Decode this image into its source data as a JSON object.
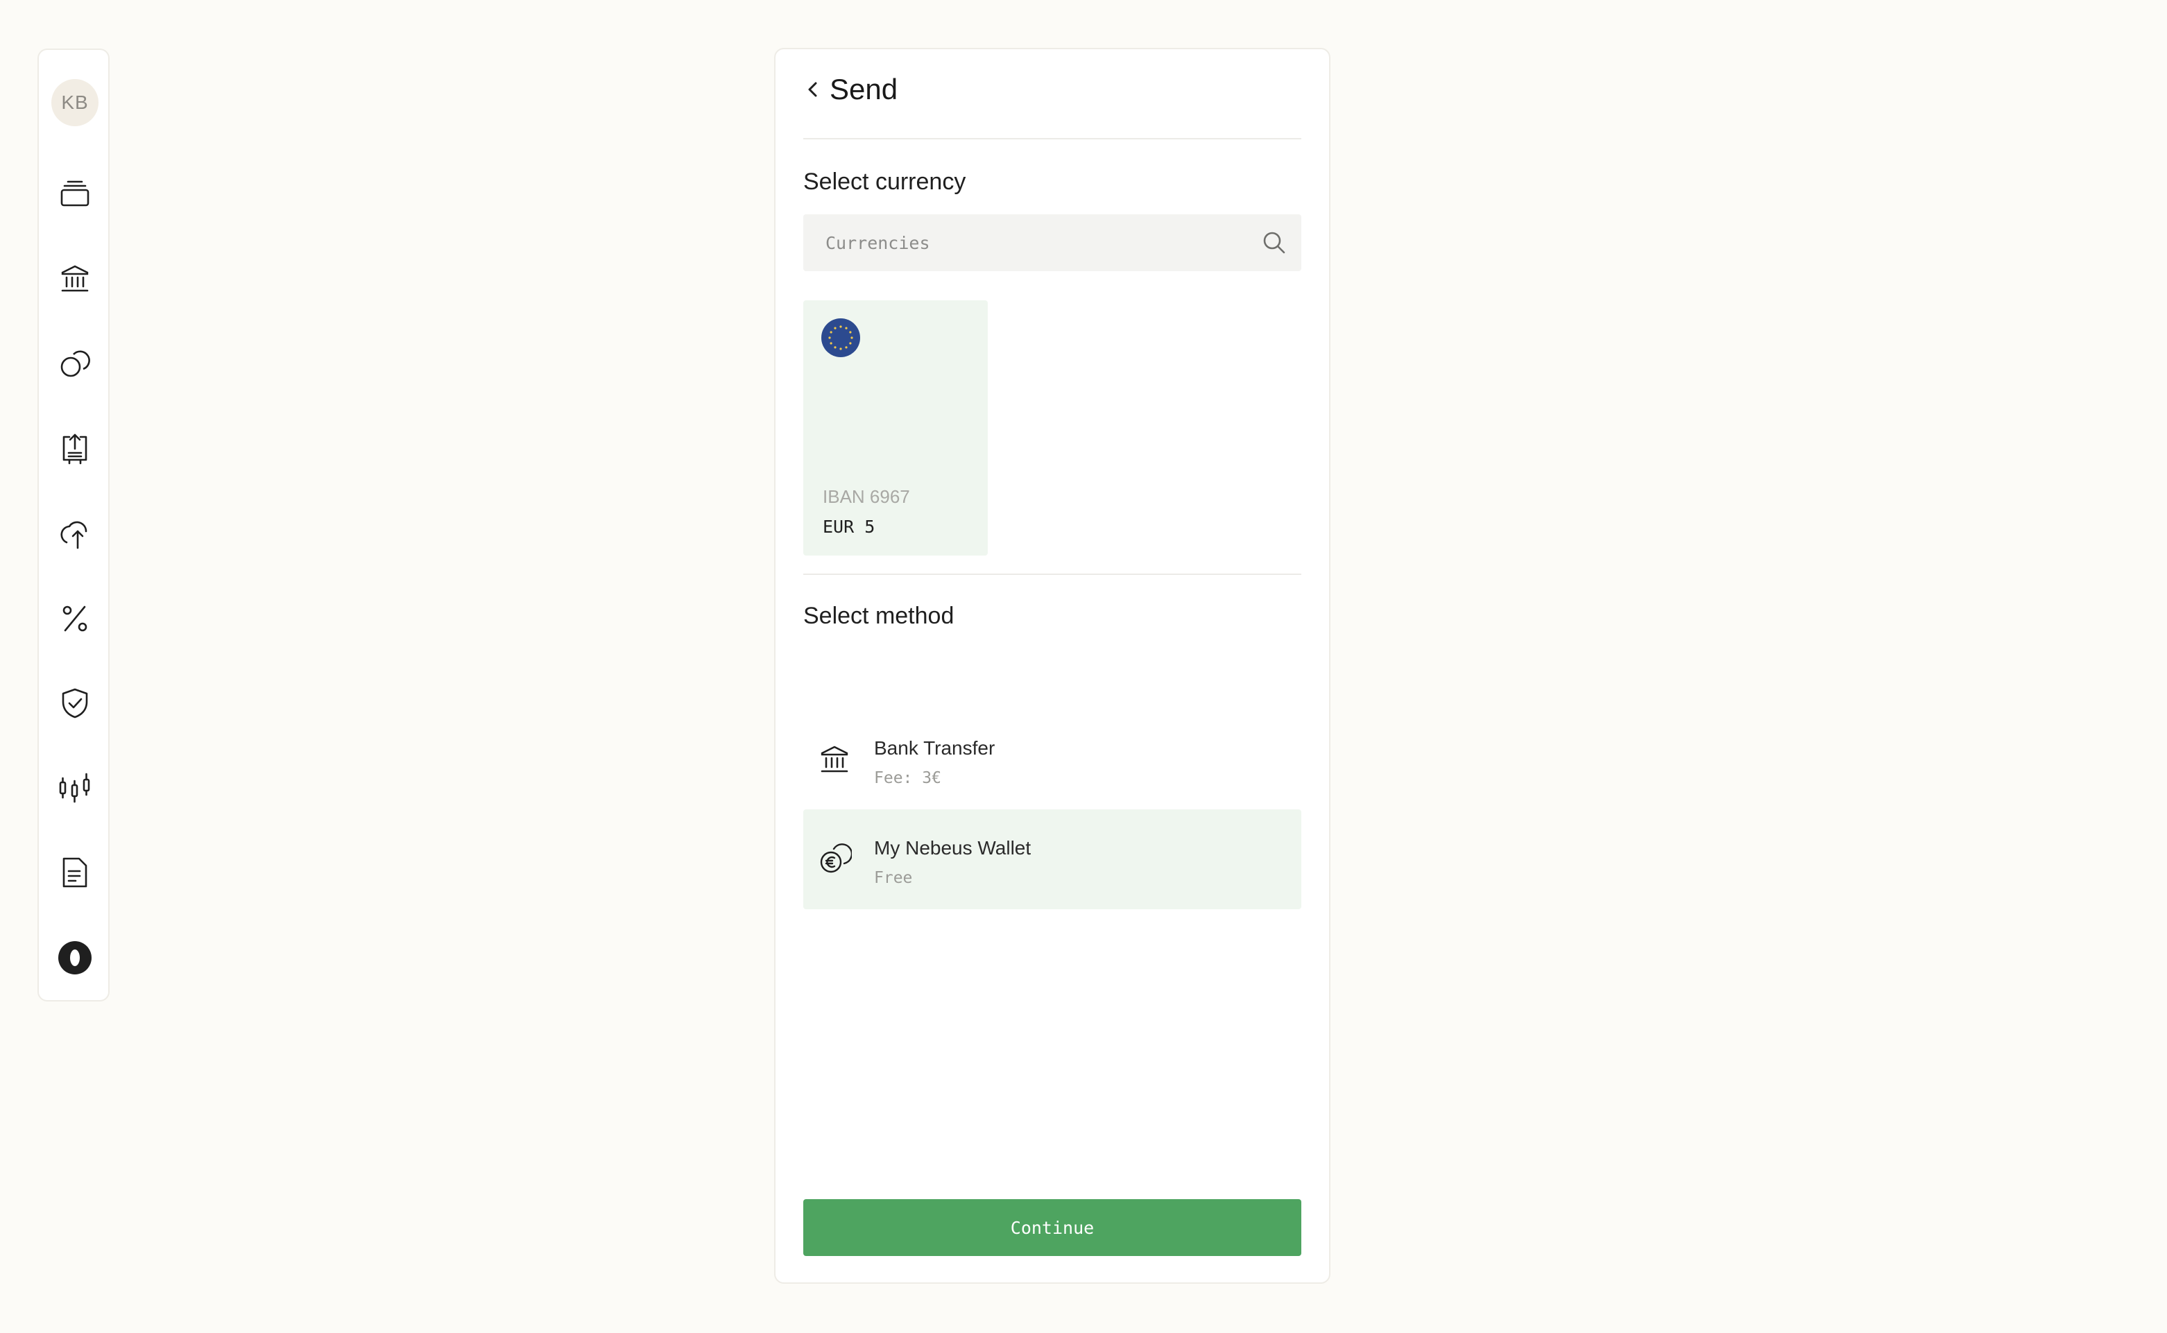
{
  "user": {
    "initials": "KB"
  },
  "sidebar": {
    "items": [
      {
        "icon": "cards-stack-icon"
      },
      {
        "icon": "bank-icon"
      },
      {
        "icon": "coins-icon"
      },
      {
        "icon": "upload-icon"
      },
      {
        "icon": "cloud-upload-icon"
      },
      {
        "icon": "percent-icon"
      },
      {
        "icon": "shield-check-icon"
      },
      {
        "icon": "candlestick-chart-icon"
      },
      {
        "icon": "document-icon"
      },
      {
        "icon": "circle-logo-icon"
      }
    ]
  },
  "header": {
    "title": "Send"
  },
  "currency_section": {
    "title": "Select currency",
    "search_placeholder": "Currencies",
    "cards": [
      {
        "flag": "eu-flag-icon",
        "account": "IBAN 6967",
        "balance": "EUR 5",
        "selected": true
      }
    ]
  },
  "method_section": {
    "title": "Select method",
    "methods": [
      {
        "icon": "bank-icon",
        "name": "Bank Transfer",
        "fee": "Fee: 3€",
        "selected": false
      },
      {
        "icon": "euro-coins-icon",
        "name": "My Nebeus Wallet",
        "fee": "Free",
        "selected": true
      }
    ]
  },
  "actions": {
    "continue_label": "Continue"
  },
  "colors": {
    "background": "#fcfbf7",
    "selected_bg": "#eff6ef",
    "primary_button": "#4ea460",
    "eu_flag_blue": "#2c4a8f"
  }
}
